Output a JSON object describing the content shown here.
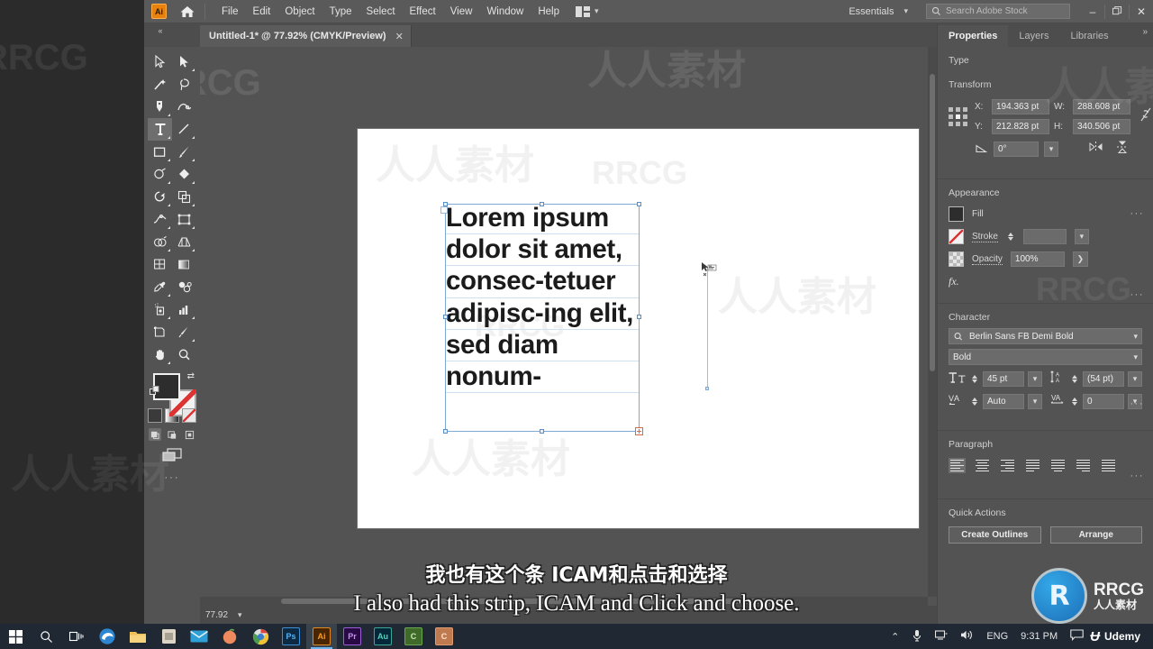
{
  "app": {
    "badge": "Ai",
    "menus": [
      "File",
      "Edit",
      "Object",
      "Type",
      "Select",
      "Effect",
      "View",
      "Window",
      "Help"
    ],
    "workspace": "Essentials",
    "search_placeholder": "Search Adobe Stock",
    "window_buttons": {
      "minimize": "–",
      "restore": "❐",
      "close": "✕"
    }
  },
  "document": {
    "tab_title": "Untitled-1* @ 77.92% (CMYK/Preview)",
    "tab_close": "✕",
    "zoom_level": "77.92",
    "text_content": "Lorem ipsum dolor sit amet, consec-tetuer adipisc-ing elit, sed diam nonum-"
  },
  "toolbar": {
    "tools": [
      {
        "name": "selection-tool",
        "glyph": "selection"
      },
      {
        "name": "direct-selection-tool",
        "glyph": "direct-selection"
      },
      {
        "name": "magic-wand-tool",
        "glyph": "magic-wand"
      },
      {
        "name": "lasso-tool",
        "glyph": "lasso"
      },
      {
        "name": "pen-tool",
        "glyph": "pen"
      },
      {
        "name": "curvature-tool",
        "glyph": "curvature"
      },
      {
        "name": "type-tool",
        "glyph": "type",
        "selected": true
      },
      {
        "name": "line-segment-tool",
        "glyph": "line"
      },
      {
        "name": "rectangle-tool",
        "glyph": "rectangle"
      },
      {
        "name": "paintbrush-tool",
        "glyph": "paintbrush"
      },
      {
        "name": "shaper-tool",
        "glyph": "shaper"
      },
      {
        "name": "eraser-tool",
        "glyph": "eraser"
      },
      {
        "name": "rotate-tool",
        "glyph": "rotate"
      },
      {
        "name": "scale-tool",
        "glyph": "scale"
      },
      {
        "name": "width-tool",
        "glyph": "width"
      },
      {
        "name": "free-transform-tool",
        "glyph": "free-transform"
      },
      {
        "name": "shape-builder-tool",
        "glyph": "shape-builder"
      },
      {
        "name": "perspective-grid-tool",
        "glyph": "perspective-grid"
      },
      {
        "name": "mesh-tool",
        "glyph": "mesh"
      },
      {
        "name": "gradient-tool",
        "glyph": "gradient"
      },
      {
        "name": "eyedropper-tool",
        "glyph": "eyedropper"
      },
      {
        "name": "blend-tool",
        "glyph": "blend"
      },
      {
        "name": "symbol-sprayer-tool",
        "glyph": "symbol-sprayer"
      },
      {
        "name": "column-graph-tool",
        "glyph": "column-graph"
      },
      {
        "name": "artboard-tool",
        "glyph": "artboard"
      },
      {
        "name": "slice-tool",
        "glyph": "slice"
      },
      {
        "name": "hand-tool",
        "glyph": "hand"
      },
      {
        "name": "zoom-tool",
        "glyph": "zoom"
      }
    ],
    "fill_color": "#2d2d2d",
    "stroke_color": "#ffffff",
    "more_tools": "···"
  },
  "panel": {
    "tabs": [
      "Properties",
      "Layers",
      "Libraries"
    ],
    "active_tab": "Properties",
    "type_label": "Type",
    "transform": {
      "title": "Transform",
      "x_label": "X:",
      "x_value": "194.363 pt",
      "y_label": "Y:",
      "y_value": "212.828 pt",
      "w_label": "W:",
      "w_value": "288.608 pt",
      "h_label": "H:",
      "h_value": "340.506 pt",
      "angle_value": "0°",
      "dots": "···"
    },
    "appearance": {
      "title": "Appearance",
      "fill_label": "Fill",
      "stroke_label": "Stroke",
      "stroke_weight": "",
      "opacity_label": "Opacity",
      "opacity_value": "100%",
      "fx_label": "fx.",
      "dots": "···"
    },
    "character": {
      "title": "Character",
      "font_family": "Berlin Sans FB Demi Bold",
      "font_style": "Bold",
      "font_size": "45 pt",
      "leading": "(54 pt)",
      "kerning": "Auto",
      "tracking": "0",
      "dots": "···"
    },
    "paragraph": {
      "title": "Paragraph",
      "align_options": [
        "align-left",
        "align-center",
        "align-right",
        "justify-last-left",
        "justify-last-center",
        "justify-last-right",
        "justify-all"
      ],
      "selected_align": "align-left",
      "dots": "···"
    },
    "quick_actions": {
      "title": "Quick Actions",
      "create_outlines": "Create Outlines",
      "arrange": "Arrange"
    }
  },
  "subtitles": {
    "chinese": "我也有这个条 ICAM和点击和选择",
    "english": "I also had this strip, ICAM and Click and choose."
  },
  "watermarks": {
    "latin": "RRCG",
    "chinese": "人人素材",
    "logo_text_main": "RRCG",
    "logo_text_sub": "人人素材",
    "logo_mark": "R"
  },
  "taskbar": {
    "apps": [
      {
        "name": "start",
        "label": "⊞",
        "color": "#ffffff"
      },
      {
        "name": "search",
        "label": "⚲",
        "color": "#ffffff"
      },
      {
        "name": "task-view",
        "label": "⎕",
        "color": "#ffffff"
      },
      {
        "name": "edge",
        "label": "e",
        "color": "#3aa0e0"
      },
      {
        "name": "file-explorer",
        "label": "▤",
        "color": "#f3c060"
      },
      {
        "name": "store",
        "label": "▣",
        "color": "#d9d2c0"
      },
      {
        "name": "mail",
        "label": "✉",
        "color": "#3aa0e0"
      },
      {
        "name": "peach-app",
        "label": "●",
        "color": "#f08a5d"
      },
      {
        "name": "chrome",
        "label": "◉",
        "color": "#d14836"
      },
      {
        "name": "photoshop",
        "label": "Ps",
        "color": "#2d6fa8"
      },
      {
        "name": "illustrator",
        "label": "Ai",
        "color": "#d07318"
      },
      {
        "name": "premiere",
        "label": "Pr",
        "color": "#8d4fc4"
      },
      {
        "name": "audition",
        "label": "Au",
        "color": "#3a9c8c"
      },
      {
        "name": "camtasia",
        "label": "C",
        "color": "#6aa84f"
      },
      {
        "name": "capture",
        "label": "C",
        "color": "#e59b72"
      }
    ],
    "tray": {
      "chevron": "⌃",
      "mic": "●",
      "network": "▦",
      "volume": "◂",
      "language": "ENG",
      "clock": "9:31 PM",
      "notifications": "▭"
    },
    "brand": "Udemy",
    "brand_mark": "Ʉ"
  }
}
